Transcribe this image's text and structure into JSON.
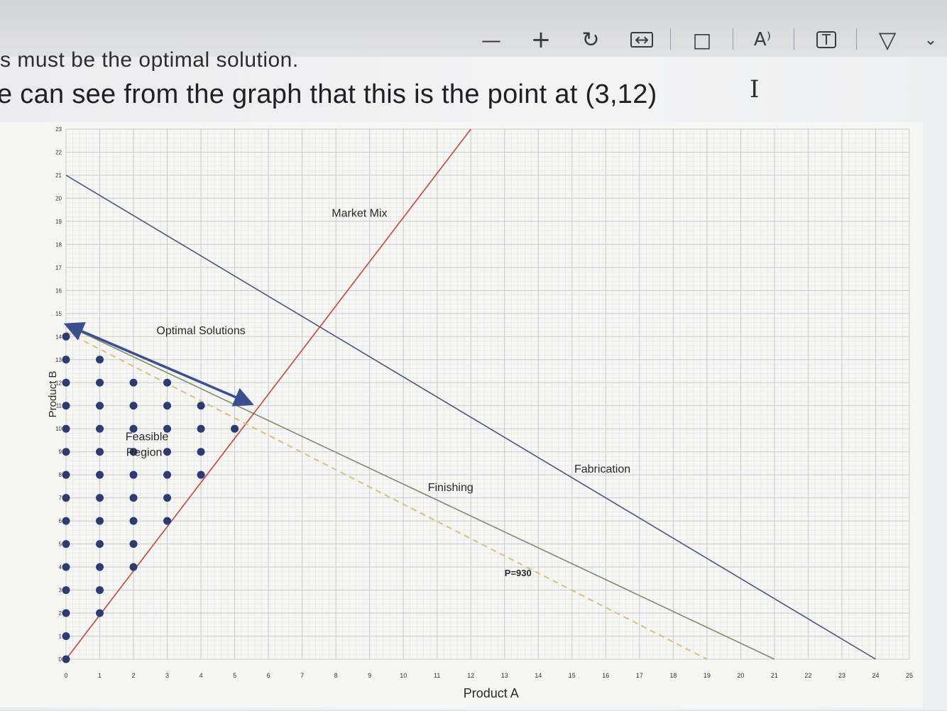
{
  "toolbar": {
    "items": [
      {
        "name": "zoom-out-icon",
        "glyph": "—"
      },
      {
        "name": "zoom-in-icon",
        "glyph": "+"
      },
      {
        "name": "rotate-icon",
        "glyph": "↻"
      },
      {
        "name": "fit-width-icon",
        "glyph": "↔"
      },
      {
        "name": "page-view-icon",
        "glyph": "□"
      },
      {
        "name": "read-aloud-icon",
        "glyph": "A⁾"
      },
      {
        "name": "text-box-icon",
        "glyph": "T"
      },
      {
        "name": "highlight-icon",
        "glyph": "▽"
      },
      {
        "name": "chevron-down-icon",
        "glyph": "⌄"
      }
    ]
  },
  "document": {
    "cut_line": "s must be the optimal solution.",
    "line": "e can see from the graph that this is the point at (3,12)"
  },
  "chart_data": {
    "type": "line",
    "xlabel": "Product A",
    "ylabel": "Product B",
    "xlim": [
      0,
      25
    ],
    "ylim": [
      0,
      23
    ],
    "x_ticks": [
      0,
      1,
      2,
      3,
      4,
      5,
      6,
      7,
      8,
      9,
      10,
      11,
      12,
      13,
      14,
      15,
      16,
      17,
      18,
      19,
      20,
      21,
      22,
      23,
      24,
      25
    ],
    "y_ticks": [
      0,
      1,
      2,
      3,
      4,
      5,
      6,
      7,
      8,
      9,
      10,
      11,
      12,
      13,
      14,
      15,
      16,
      17,
      18,
      19,
      20,
      21,
      22,
      23
    ],
    "series": [
      {
        "name": "Fabrication",
        "color": "#4a5a78",
        "points": [
          [
            0,
            21
          ],
          [
            24,
            0
          ]
        ]
      },
      {
        "name": "Finishing",
        "color": "#7d8f6a",
        "points": [
          [
            0,
            14.5
          ],
          [
            21,
            0
          ]
        ]
      },
      {
        "name": "Market Mix",
        "color": "#c8463a",
        "points": [
          [
            0,
            0
          ],
          [
            12,
            23
          ]
        ]
      },
      {
        "name": "P=930",
        "color": "#d8c27a",
        "dashed": true,
        "points": [
          [
            0,
            14.2
          ],
          [
            19,
            0
          ]
        ]
      }
    ],
    "annotations": [
      {
        "text": "Market Mix",
        "x": 8.7,
        "y": 19.2
      },
      {
        "text": "Optimal Solutions",
        "x": 4,
        "y": 14.1
      },
      {
        "text": "Feasible Region",
        "x": 2.4,
        "y": 9.5
      },
      {
        "text": "Finishing",
        "x": 11.4,
        "y": 7.3
      },
      {
        "text": "Fabrication",
        "x": 15.9,
        "y": 8.1
      },
      {
        "text": "P=930",
        "x": 13.4,
        "y": 3.6
      }
    ],
    "optimal_arrow": {
      "from": [
        0.2,
        14.4
      ],
      "to": [
        5.3,
        11.2
      ],
      "color": "#3b4f8f"
    },
    "feasible_points": [
      [
        0,
        0
      ],
      [
        0,
        1
      ],
      [
        0,
        2
      ],
      [
        0,
        3
      ],
      [
        0,
        4
      ],
      [
        0,
        5
      ],
      [
        0,
        6
      ],
      [
        0,
        7
      ],
      [
        0,
        8
      ],
      [
        0,
        9
      ],
      [
        0,
        10
      ],
      [
        0,
        11
      ],
      [
        0,
        12
      ],
      [
        0,
        13
      ],
      [
        0,
        14
      ],
      [
        1,
        2
      ],
      [
        1,
        3
      ],
      [
        1,
        4
      ],
      [
        1,
        5
      ],
      [
        1,
        6
      ],
      [
        1,
        7
      ],
      [
        1,
        8
      ],
      [
        1,
        9
      ],
      [
        1,
        10
      ],
      [
        1,
        11
      ],
      [
        1,
        12
      ],
      [
        1,
        13
      ],
      [
        2,
        4
      ],
      [
        2,
        5
      ],
      [
        2,
        6
      ],
      [
        2,
        7
      ],
      [
        2,
        8
      ],
      [
        2,
        9
      ],
      [
        2,
        10
      ],
      [
        2,
        11
      ],
      [
        2,
        12
      ],
      [
        3,
        6
      ],
      [
        3,
        7
      ],
      [
        3,
        8
      ],
      [
        3,
        9
      ],
      [
        3,
        10
      ],
      [
        3,
        11
      ],
      [
        3,
        12
      ],
      [
        4,
        8
      ],
      [
        4,
        9
      ],
      [
        4,
        10
      ],
      [
        4,
        11
      ],
      [
        5,
        10
      ]
    ],
    "point_color": "#2b3c73"
  }
}
